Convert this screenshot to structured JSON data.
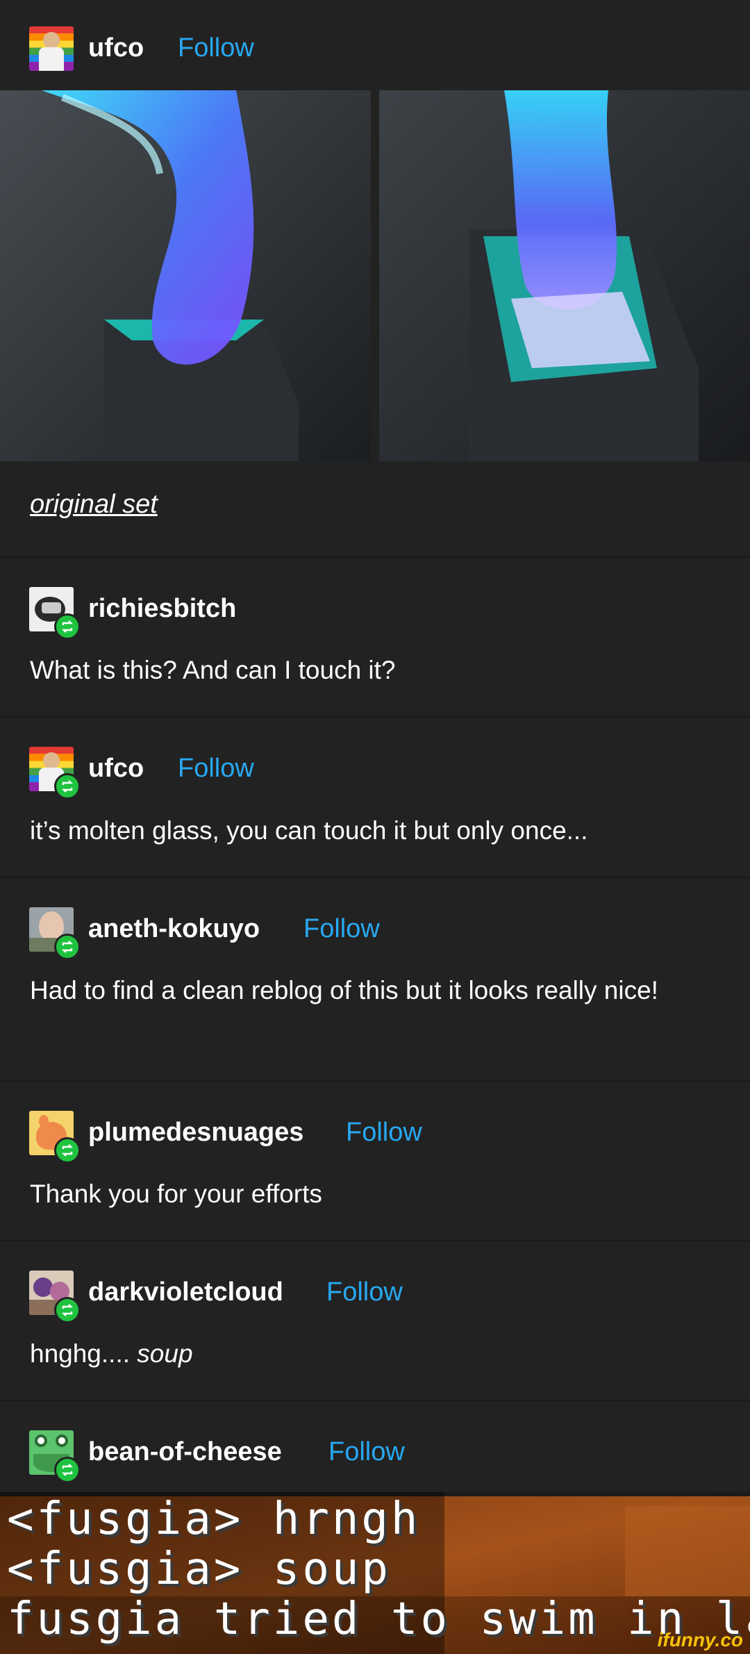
{
  "op": {
    "username": "ufco",
    "follow_label": "Follow"
  },
  "photos": [
    {
      "icon": "molten-glass-photo-left"
    },
    {
      "icon": "molten-glass-photo-right"
    }
  ],
  "caption": {
    "link_text": "original set"
  },
  "reblogs": [
    {
      "username": "richiesbitch",
      "text": "What is this? And can I touch it?",
      "follow": ""
    },
    {
      "username": "ufco",
      "text": "it’s molten glass, you can touch it but only once...",
      "follow": "Follow"
    },
    {
      "username": "aneth-kokuyo",
      "text": "Had to find a clean reblog of this but it looks really nice!",
      "follow": "Follow"
    },
    {
      "username": "plumedesnuages",
      "text": "Thank you for your efforts",
      "follow": "Follow"
    },
    {
      "username": "darkvioletcloud",
      "text": "hnghg.... ",
      "text_em": "soup",
      "follow": "Follow"
    },
    {
      "username": "bean-of-cheese",
      "text": "",
      "follow": "Follow"
    }
  ],
  "meme": {
    "line1": "<fusgia> hrngh",
    "line2": "<fusgia> soup",
    "line3": "fusgia tried to swim in lava",
    "watermark": "ifunny.co"
  },
  "colors": {
    "background": "#222222",
    "follow": "#27a9f2",
    "reblog_badge": "#1fc33f",
    "glass_glow": "#5aa8ff"
  }
}
